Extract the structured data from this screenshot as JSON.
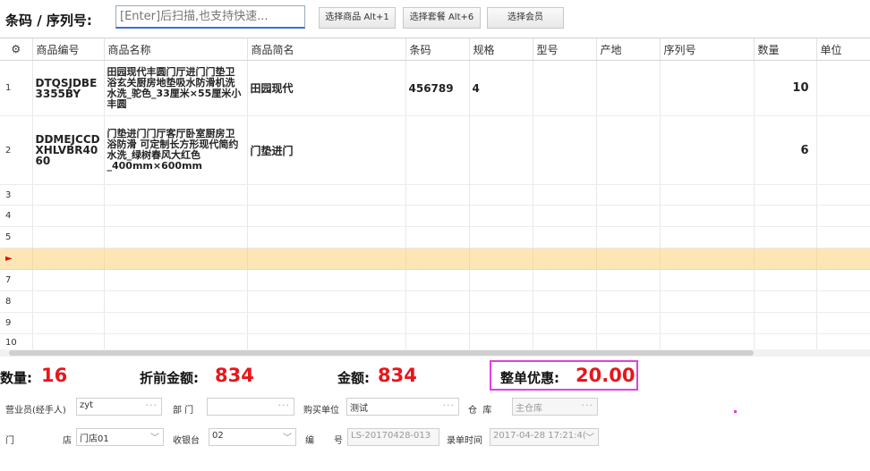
{
  "toolbar": {
    "scan_label": "条码 / 序列号:",
    "scan_placeholder": "[Enter]后扫描,也支持快速...",
    "btn_select_goods": "选择商品 Alt+1",
    "btn_select_package": "选择套餐 Alt+6",
    "btn_select_member": "选择会员"
  },
  "grid": {
    "columns": [
      "商品编号",
      "商品名称",
      "商品简名",
      "条码",
      "规格",
      "型号",
      "产地",
      "序列号",
      "数量",
      "单位"
    ],
    "rows": [
      {
        "n": "1",
        "code": "DTQSJDBE3355BY",
        "name": "田园现代丰圆门厅进门门垫卫浴玄关厨房地垫吸水防滑机洗水洗_驼色_33厘米×55厘米小丰圆",
        "short": "田园现代",
        "barcode": "456789",
        "spec": "4",
        "model": "",
        "origin": "",
        "serial": "",
        "qty": "10",
        "unit": ""
      },
      {
        "n": "2",
        "code": "DDMEJCCDXHLVBR4060",
        "name": "门垫进门门厅客厅卧室厨房卫浴防滑 可定制长方形现代简约水洗_绿树春风大红色_400mm×600mm",
        "short": "门垫进门",
        "barcode": "",
        "spec": "",
        "model": "",
        "origin": "",
        "serial": "",
        "qty": "6",
        "unit": ""
      },
      {
        "n": "3"
      },
      {
        "n": "4"
      },
      {
        "n": "5"
      },
      {
        "n": "►"
      },
      {
        "n": "7"
      },
      {
        "n": "8"
      },
      {
        "n": "9"
      },
      {
        "n": "10"
      }
    ]
  },
  "summary": {
    "qty_label": "数量:",
    "qty_value": "16",
    "pre_label": "折前金额:",
    "pre_value": "834",
    "amt_label": "金额:",
    "amt_value": "834",
    "disc_label": "整单优惠:",
    "disc_value": "20.00"
  },
  "form": {
    "salesman_label": "营业员(经手人)",
    "salesman_value": "zyt",
    "dept_label": "部 门",
    "dept_value": "",
    "buyer_label": "购买单位",
    "buyer_value": "测试",
    "store_label": "仓  库",
    "store_value": "主仓库",
    "shop_label1": "门",
    "shop_label2": "店",
    "shop_value": "门店01",
    "cashier_label": "收银台",
    "cashier_value": "02",
    "no_label1": "编",
    "no_label2": "号",
    "no_value": "LS-20170428-013",
    "time_label": "录单时间",
    "time_value": "2017-04-28 17:21:4("
  }
}
